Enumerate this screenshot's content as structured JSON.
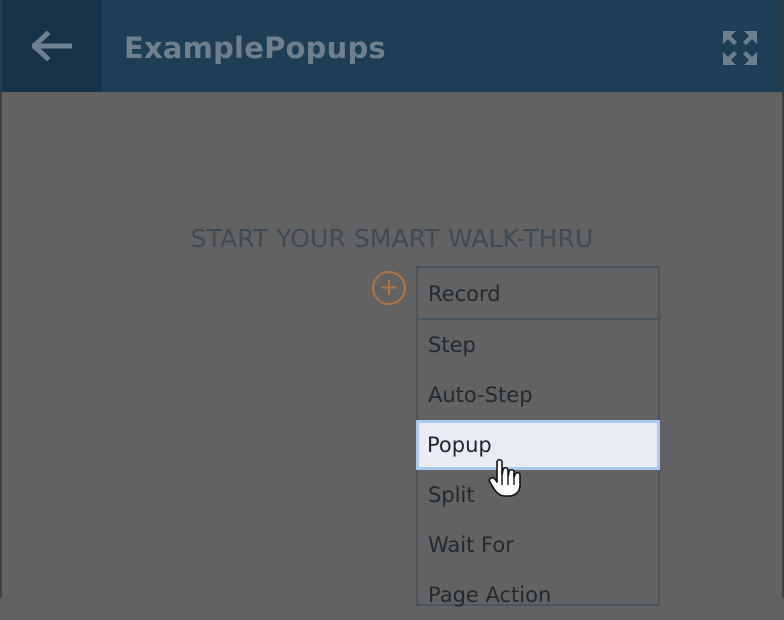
{
  "header": {
    "back_icon": "arrow-left-icon",
    "title": "ExamplePopups",
    "expand_icon": "expand-icon"
  },
  "main": {
    "heading": "START YOUR SMART WALK-THRU",
    "add_icon": "plus-circle-icon",
    "add_glyph": "+",
    "dropdown": {
      "selected": "Record",
      "options": [
        "Step",
        "Auto-Step",
        "Popup",
        "Split",
        "Wait For",
        "Page Action"
      ],
      "highlighted": "Popup"
    }
  },
  "colors": {
    "header_bg": "#1d3e54",
    "overlay": "#626262",
    "accent_orange": "#b4733f",
    "highlight_border": "#a9c9ee"
  }
}
